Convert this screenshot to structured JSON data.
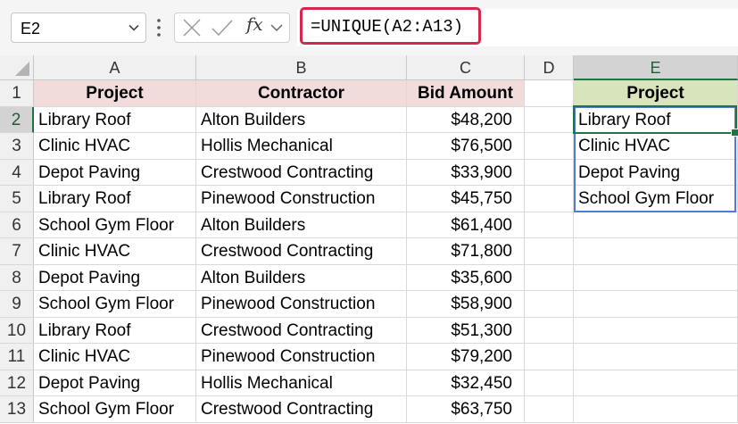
{
  "formula_bar": {
    "name_box": "E2",
    "fx_label": "fx",
    "formula": "=UNIQUE(A2:A13)",
    "icons": [
      "chevron-down-icon",
      "more-options-icon",
      "cancel-icon",
      "enter-check-icon",
      "insert-function-icon",
      "expand-formula-icon"
    ]
  },
  "grid": {
    "columns": [
      "A",
      "B",
      "C",
      "D",
      "E"
    ],
    "rows": [
      "1",
      "2",
      "3",
      "4",
      "5",
      "6",
      "7",
      "8",
      "9",
      "10",
      "11",
      "12",
      "13"
    ],
    "selected_column": "E",
    "selected_row": "2",
    "table": {
      "headers": [
        "Project",
        "Contractor",
        "Bid Amount"
      ],
      "rows": [
        [
          "Library Roof",
          "Alton Builders",
          "$48,200"
        ],
        [
          "Clinic HVAC",
          "Hollis Mechanical",
          "$76,500"
        ],
        [
          "Depot Paving",
          "Crestwood Contracting",
          "$33,900"
        ],
        [
          "Library Roof",
          "Pinewood Construction",
          "$45,750"
        ],
        [
          "School Gym Floor",
          "Alton Builders",
          "$61,400"
        ],
        [
          "Clinic HVAC",
          "Crestwood Contracting",
          "$71,800"
        ],
        [
          "Depot Paving",
          "Alton Builders",
          "$35,600"
        ],
        [
          "School Gym Floor",
          "Pinewood Construction",
          "$58,900"
        ],
        [
          "Library Roof",
          "Crestwood Contracting",
          "$51,300"
        ],
        [
          "Clinic HVAC",
          "Pinewood Construction",
          "$79,200"
        ],
        [
          "Depot Paving",
          "Hollis Mechanical",
          "$32,450"
        ],
        [
          "School Gym Floor",
          "Crestwood Contracting",
          "$63,750"
        ]
      ]
    },
    "unique_result": {
      "header": "Project",
      "values": [
        "Library Roof",
        "Clinic HVAC",
        "Depot Paving",
        "School Gym Floor"
      ]
    }
  },
  "colors": {
    "header_fill": "#f2dcdb",
    "result_header_fill": "#d8e4bc",
    "formula_highlight": "#d6264d",
    "active_cell_border": "#217346",
    "spill_border": "#4f7bd6"
  }
}
